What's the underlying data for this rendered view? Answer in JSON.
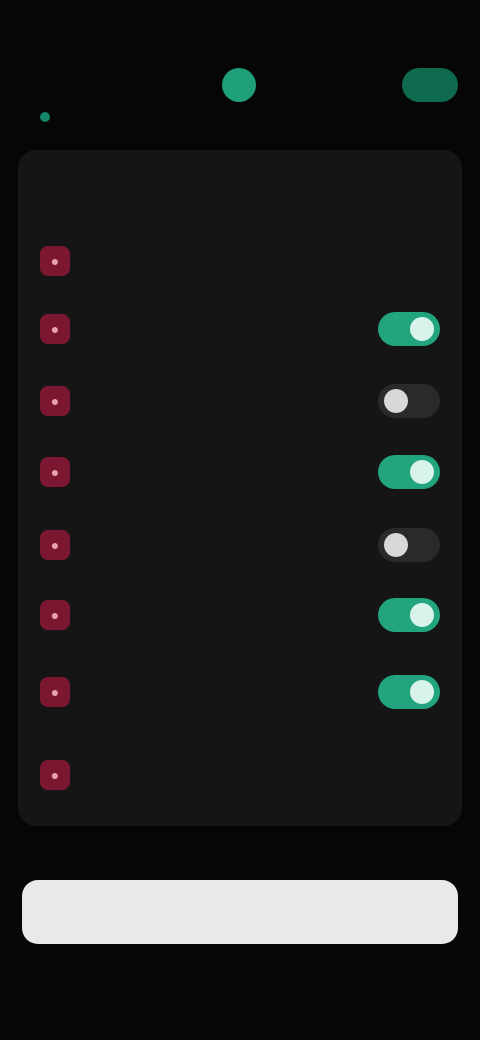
{
  "status_bar": {
    "time": "",
    "right": ""
  },
  "header": {
    "subtitle": ""
  },
  "settings": {
    "section_title": "",
    "items": [
      {
        "label": "",
        "icon": "lock-icon",
        "toggle": null
      },
      {
        "label": "",
        "icon": "shield-icon",
        "toggle": true
      },
      {
        "label": "",
        "icon": "eye-icon",
        "toggle": false
      },
      {
        "label": "",
        "icon": "key-icon",
        "toggle": true
      },
      {
        "label": "",
        "icon": "bell-icon",
        "toggle": false
      },
      {
        "label": "",
        "icon": "globe-icon",
        "toggle": true
      },
      {
        "label": "",
        "icon": "fingerprint-icon",
        "toggle": true
      },
      {
        "label": "",
        "icon": "info-icon",
        "toggle": null
      }
    ]
  },
  "footer": {
    "primary_label": ""
  },
  "colors": {
    "background": "#060606",
    "card": "#151515",
    "accent": "#22a47e",
    "icon_tile": "#7b1730",
    "button": "#e9e9e9"
  }
}
